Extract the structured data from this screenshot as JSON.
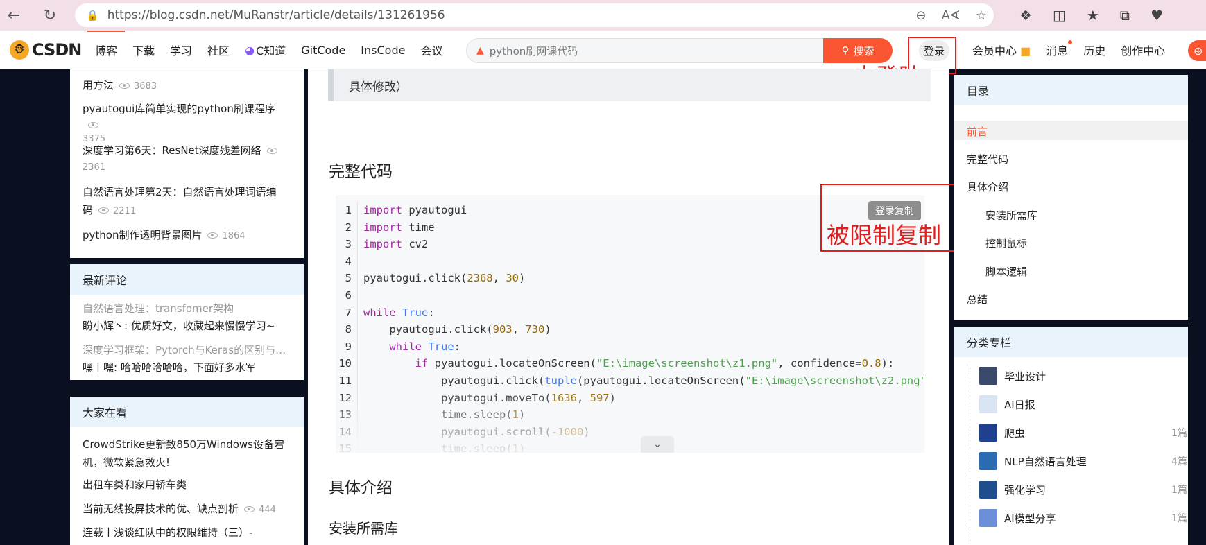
{
  "browser": {
    "url": "https://blog.csdn.net/MuRanstr/article/details/131261956"
  },
  "topnav": {
    "logo": "CSDN",
    "items": [
      "博客",
      "下载",
      "学习",
      "社区",
      "C知道",
      "GitCode",
      "InsCode",
      "会议"
    ],
    "search_placeholder": "python刷网课代码",
    "search_button": "搜索",
    "login": "登录",
    "right_items": [
      "会员中心",
      "消息",
      "历史",
      "创作中心"
    ]
  },
  "annotations": {
    "not_logged_in": "未登陆",
    "copy_restricted": "被限制复制",
    "copy_button": "登录复制"
  },
  "left_sidebar": {
    "popular": [
      {
        "title": "用方法",
        "views": "3683"
      },
      {
        "title": "pyautogui库简单实现的python刷课程序",
        "views": "3375"
      },
      {
        "title": "深度学习第6天：ResNet深度残差网络",
        "views": "2361"
      },
      {
        "title_line1": "自然语言处理第2天：自然语言处理词语编",
        "title_line2": "码",
        "views": "2211"
      },
      {
        "title": "python制作透明背景图片",
        "views": "1864"
      }
    ],
    "latest_comments": {
      "title": "最新评论",
      "items": [
        {
          "post": "自然语言处理：transfomer架构",
          "comment": "盼小辉丶: 优质好文，收藏起来慢慢学习~"
        },
        {
          "post": "深度学习框架：Pytorch与Keras的区别与使用方法",
          "comment": "嘿丨嘿: 哈哈哈哈哈哈，下面好多水军"
        }
      ]
    },
    "everyone_watching": {
      "title": "大家在看",
      "items": [
        {
          "line1": "CrowdStrike更新致850万Windows设备宕",
          "line2": "机，微软紧急救火!"
        },
        {
          "line1": "出租车类和家用轿车类"
        },
        {
          "line1": "当前无线投屏技术的优、缺点剖析",
          "views": "444"
        },
        {
          "line1": "连载丨浅谈红队中的权限维持（三）-"
        }
      ]
    }
  },
  "article": {
    "quote_tail": "具体修改）",
    "h_full_code": "完整代码",
    "code_lines": [
      {
        "n": "1",
        "html": "<span class='kw'>import</span> pyautogui"
      },
      {
        "n": "2",
        "html": "<span class='kw'>import</span> time"
      },
      {
        "n": "3",
        "html": "<span class='kw'>import</span> cv2"
      },
      {
        "n": "4",
        "html": ""
      },
      {
        "n": "5",
        "html": "pyautogui.click(<span class='num'>2368</span>, <span class='num'>30</span>)"
      },
      {
        "n": "6",
        "html": ""
      },
      {
        "n": "7",
        "html": "<span class='kw'>while</span> <span class='bi'>True</span>:"
      },
      {
        "n": "8",
        "html": "    pyautogui.click(<span class='num'>903</span>, <span class='num'>730</span>)"
      },
      {
        "n": "9",
        "html": "    <span class='kw'>while</span> <span class='bi'>True</span>:"
      },
      {
        "n": "10",
        "html": "        <span class='kw'>if</span> pyautogui.locateOnScreen(<span class='str'>\"E:\\image\\screenshot\\z1.png\"</span>, confidence=<span class='num'>0.8</span>):"
      },
      {
        "n": "11",
        "html": "            pyautogui.click(<span class='bi'>tuple</span>(pyautogui.locateOnScreen(<span class='str'>\"E:\\image\\screenshot\\z2.png\"</span>"
      },
      {
        "n": "12",
        "html": "            pyautogui.moveTo(<span class='num'>1636</span>, <span class='num'>597</span>)"
      },
      {
        "n": "13",
        "html": "            time.sleep(<span class='num'>1</span>)"
      },
      {
        "n": "14",
        "html": "            pyautogui.scroll(<span class='num'>-1000</span>)"
      },
      {
        "n": "15",
        "html": "            time.sleep(<span class='num'>1</span>)"
      }
    ],
    "h_details": "具体介绍",
    "h_install": "安装所需库"
  },
  "right_sidebar": {
    "toc_title": "目录",
    "toc": [
      {
        "label": "前言",
        "active": true,
        "level": 1
      },
      {
        "label": "完整代码",
        "level": 1
      },
      {
        "label": "具体介绍",
        "level": 1
      },
      {
        "label": "安装所需库",
        "level": 2
      },
      {
        "label": "控制鼠标",
        "level": 2
      },
      {
        "label": "脚本逻辑",
        "level": 2
      },
      {
        "label": "总结",
        "level": 1
      }
    ],
    "category_title": "分类专栏",
    "categories": [
      {
        "name": "毕业设计",
        "count": "",
        "color": "#3a4a6b"
      },
      {
        "name": "AI日报",
        "count": "",
        "color": "#d9e4f5"
      },
      {
        "name": "爬虫",
        "count": "1篇",
        "color": "#1f3f8f"
      },
      {
        "name": "NLP自然语言处理",
        "count": "4篇",
        "color": "#2b6cb0"
      },
      {
        "name": "强化学习",
        "count": "1篇",
        "color": "#1e4e8c"
      },
      {
        "name": "AI模型分享",
        "count": "1篇",
        "color": "#6b8fd6"
      }
    ]
  }
}
